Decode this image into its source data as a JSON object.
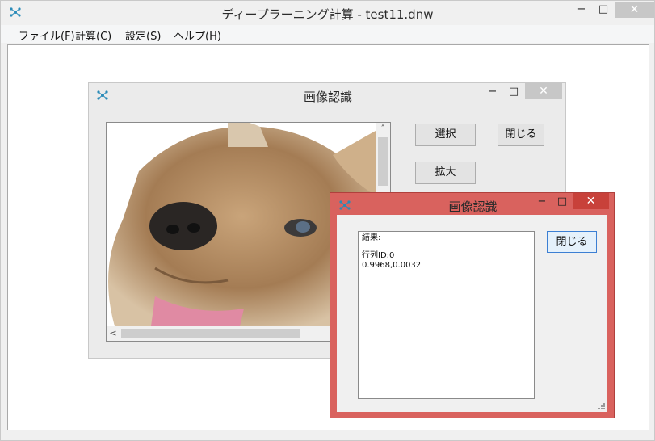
{
  "main_window": {
    "title": "ディープラーニング計算 - test11.dnw",
    "menu": [
      "ファイル(F)",
      "計算(C)",
      "設定(S)",
      "ヘルプ(H)"
    ],
    "buttons": {
      "minimize": "−",
      "maximize": "□",
      "close": "✕"
    }
  },
  "image_window": {
    "title": "画像認識",
    "buttons": {
      "minimize": "−",
      "maximize": "□",
      "close": "✕",
      "select": "選択",
      "close_dialog": "閉じる",
      "zoom": "拡大"
    },
    "scroll": {
      "up": "˄",
      "left": "<"
    }
  },
  "result_window": {
    "title": "画像認識",
    "buttons": {
      "minimize": "−",
      "maximize": "□",
      "close": "✕",
      "close_dialog": "閉じる"
    },
    "result": {
      "label": "結果:",
      "line1": "行列ID:0",
      "line2": "0.9968,0.0032"
    }
  },
  "colors": {
    "result_frame": "#d9625e",
    "result_close": "#c8413a"
  }
}
